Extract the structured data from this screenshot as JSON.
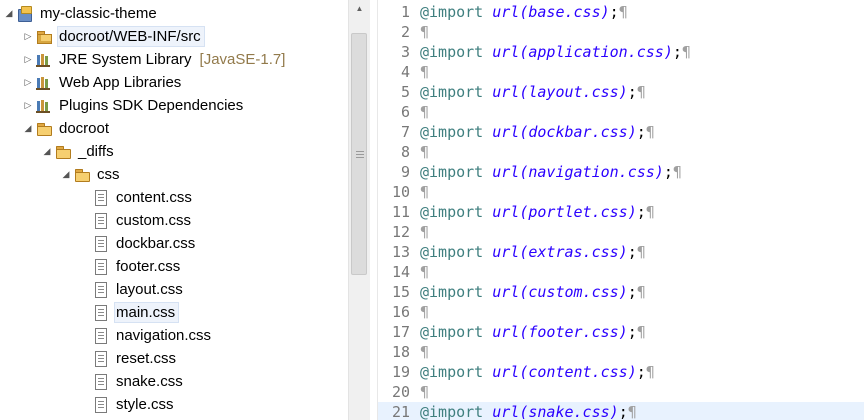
{
  "tree": {
    "items": [
      {
        "label": "my-classic-theme",
        "icon": "project-icon",
        "expander": "expanded",
        "indent": 0
      },
      {
        "label": "docroot/WEB-INF/src",
        "icon": "source-folder-icon",
        "expander": "collapsed",
        "indent": 1,
        "selected": true
      },
      {
        "label": "JRE System Library",
        "extra": "[JavaSE-1.7]",
        "icon": "library-icon",
        "expander": "collapsed",
        "indent": 1
      },
      {
        "label": "Web App Libraries",
        "icon": "library-icon",
        "expander": "collapsed",
        "indent": 1
      },
      {
        "label": "Plugins SDK Dependencies",
        "icon": "library-icon",
        "expander": "collapsed",
        "indent": 1
      },
      {
        "label": "docroot",
        "icon": "folder-open-icon",
        "expander": "expanded",
        "indent": 1
      },
      {
        "label": "_diffs",
        "icon": "folder-open-icon",
        "expander": "expanded",
        "indent": 2
      },
      {
        "label": "css",
        "icon": "folder-open-icon",
        "expander": "expanded",
        "indent": 3
      },
      {
        "label": "content.css",
        "icon": "file-icon",
        "indent": 4
      },
      {
        "label": "custom.css",
        "icon": "file-icon",
        "indent": 4
      },
      {
        "label": "dockbar.css",
        "icon": "file-icon",
        "indent": 4
      },
      {
        "label": "footer.css",
        "icon": "file-icon",
        "indent": 4
      },
      {
        "label": "layout.css",
        "icon": "file-icon",
        "indent": 4
      },
      {
        "label": "main.css",
        "icon": "file-icon",
        "indent": 4,
        "selected": true
      },
      {
        "label": "navigation.css",
        "icon": "file-icon",
        "indent": 4
      },
      {
        "label": "reset.css",
        "icon": "file-icon",
        "indent": 4
      },
      {
        "label": "snake.css",
        "icon": "file-icon",
        "indent": 4
      },
      {
        "label": "style.css",
        "icon": "file-icon",
        "indent": 4
      }
    ]
  },
  "editor": {
    "import_kw": "@import",
    "pilcrow": "¶",
    "current_line": 21,
    "lines": [
      {
        "n": "1",
        "url": "url(base.css)",
        "semi": ";"
      },
      {
        "n": "2"
      },
      {
        "n": "3",
        "url": "url(application.css)",
        "semi": ";"
      },
      {
        "n": "4"
      },
      {
        "n": "5",
        "url": "url(layout.css)",
        "semi": ";"
      },
      {
        "n": "6"
      },
      {
        "n": "7",
        "url": "url(dockbar.css)",
        "semi": ";"
      },
      {
        "n": "8"
      },
      {
        "n": "9",
        "url": "url(navigation.css)",
        "semi": ";"
      },
      {
        "n": "10"
      },
      {
        "n": "11",
        "url": "url(portlet.css)",
        "semi": ";"
      },
      {
        "n": "12"
      },
      {
        "n": "13",
        "url": "url(extras.css)",
        "semi": ";"
      },
      {
        "n": "14"
      },
      {
        "n": "15",
        "url": "url(custom.css)",
        "semi": ";"
      },
      {
        "n": "16"
      },
      {
        "n": "17",
        "url": "url(footer.css)",
        "semi": ";"
      },
      {
        "n": "18"
      },
      {
        "n": "19",
        "url": "url(content.css)",
        "semi": ";"
      },
      {
        "n": "20"
      },
      {
        "n": "21",
        "url": "url(snake.css)",
        "semi": ";"
      }
    ]
  },
  "colors": {
    "keyword": "#3f7f7f",
    "function": "#2a00ff",
    "current_line": "#e8f2fe",
    "tree_extra": "#927a4b"
  }
}
